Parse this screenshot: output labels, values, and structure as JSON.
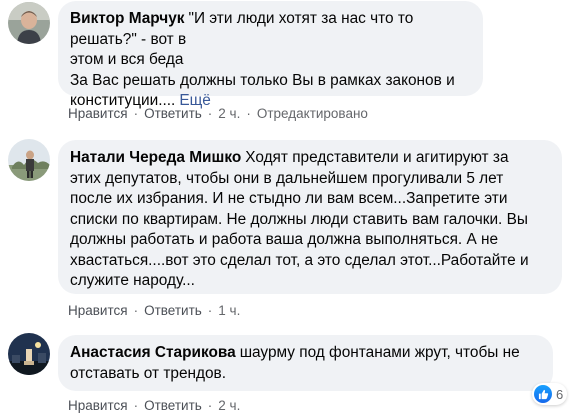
{
  "comments": [
    {
      "author": "Виктор Марчук",
      "lines": [
        "\"И эти люди хотят за нас что то решать?\" - вот в",
        "этом и вся беда",
        "За Вас решать должны только Вы в рамках законов и",
        "конституции...."
      ],
      "more": "Ещё",
      "actions": {
        "like": "Нравится",
        "reply": "Ответить",
        "time": "2 ч.",
        "edited": "Отредактировано"
      }
    },
    {
      "author": "Натали Череда Мишко",
      "lines": [
        "Ходят представители и агитируют за",
        "этих депутатов, чтобы они в дальнейшем прогуливали 5 лет",
        "после их избрания. И не стыдно ли вам всем...Запретите эти",
        "списки по квартирам. Не должны люди ставить вам галочки. Вы",
        "должны работать и работа ваша должна выполняться. А не",
        "хвастаться....вот это сделал тот, а это сделал этот...Работайте и",
        "служите народу..."
      ],
      "actions": {
        "like": "Нравится",
        "reply": "Ответить",
        "time": "1 ч."
      }
    },
    {
      "author": "Анастасия Старикова",
      "lines": [
        "шаурму под фонтанами жрут, чтобы не",
        "отставать от трендов."
      ],
      "reactions": {
        "count": "6",
        "icon": "like-icon"
      },
      "actions": {
        "like": "Нравится",
        "reply": "Ответить",
        "time": "2 ч."
      }
    }
  ],
  "colors": {
    "bubble": "#f0f2f5",
    "link": "#385898",
    "meta": "#65676b",
    "like": "#1877f2"
  }
}
